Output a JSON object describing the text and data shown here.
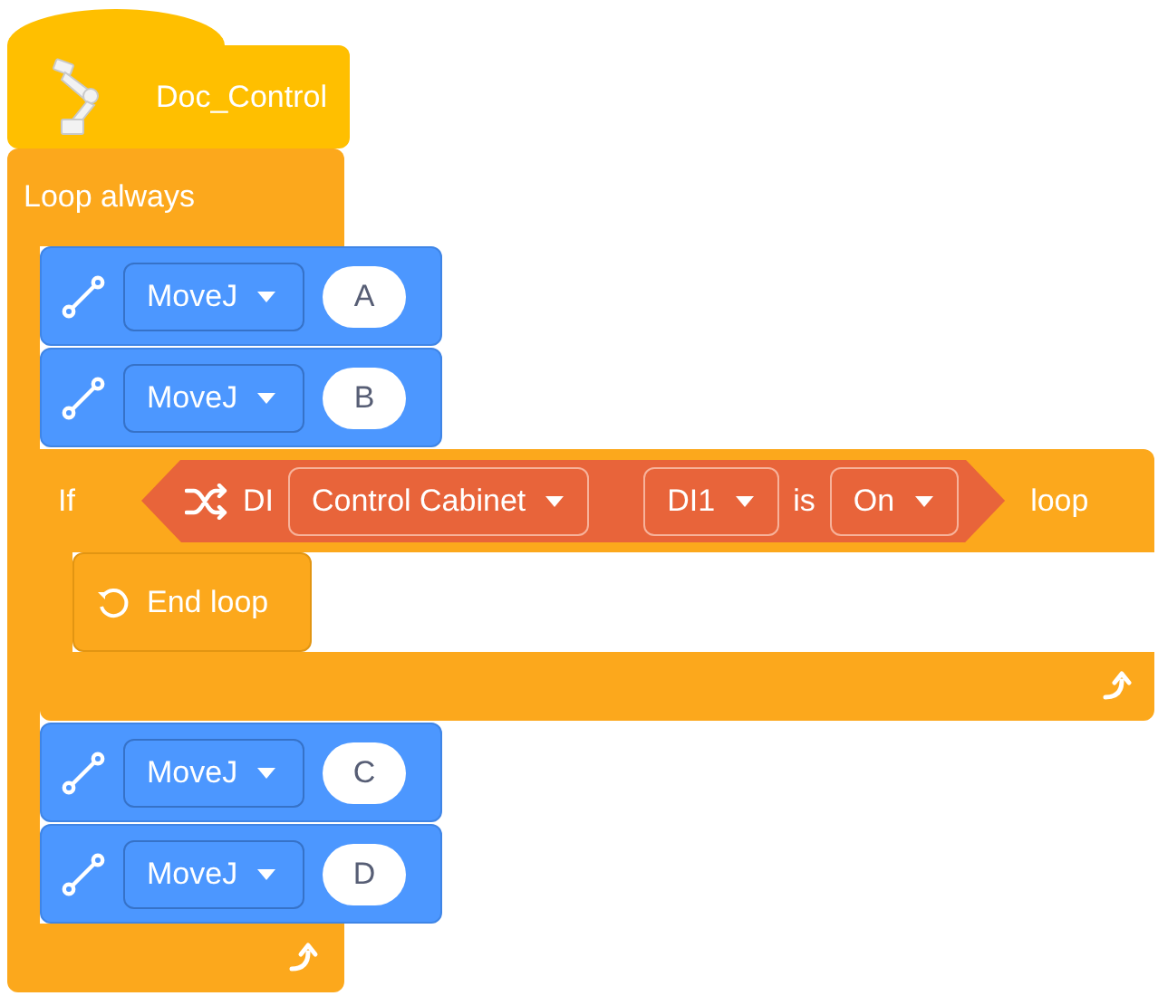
{
  "program": {
    "title": "Doc_Control",
    "loop": {
      "label": "Loop always",
      "body": [
        {
          "kind": "move",
          "command": "MoveJ",
          "point": "A"
        },
        {
          "kind": "move",
          "command": "MoveJ",
          "point": "B"
        },
        {
          "kind": "if",
          "label": "If",
          "condition": {
            "prefix": "DI",
            "source": "Control Cabinet",
            "port": "DI1",
            "operator": "is",
            "state": "On"
          },
          "suffix": "loop",
          "body": [
            {
              "kind": "end_loop",
              "label": "End loop"
            }
          ]
        },
        {
          "kind": "move",
          "command": "MoveJ",
          "point": "C"
        },
        {
          "kind": "move",
          "command": "MoveJ",
          "point": "D"
        }
      ]
    }
  }
}
